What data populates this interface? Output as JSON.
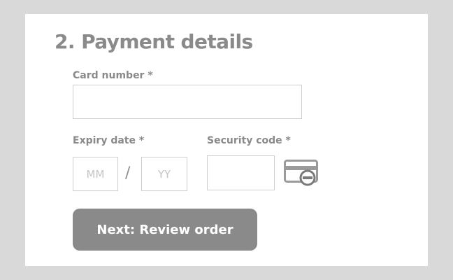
{
  "section": {
    "title": "2. Payment details"
  },
  "card_number": {
    "label": "Card number *",
    "value": ""
  },
  "expiry": {
    "label": "Expiry date *",
    "month_placeholder": "MM",
    "year_placeholder": "YY",
    "separator": "/"
  },
  "security_code": {
    "label": "Security code *",
    "value": "",
    "icon": "credit-card-cvv-icon"
  },
  "actions": {
    "next_label": "Next: Review order"
  },
  "colors": {
    "background": "#d9d9d9",
    "panel": "#ffffff",
    "text_gray": "#8a8a8a",
    "border_gray": "#cfcfcf",
    "button_fill": "#8a8a8a",
    "button_text": "#ffffff"
  }
}
